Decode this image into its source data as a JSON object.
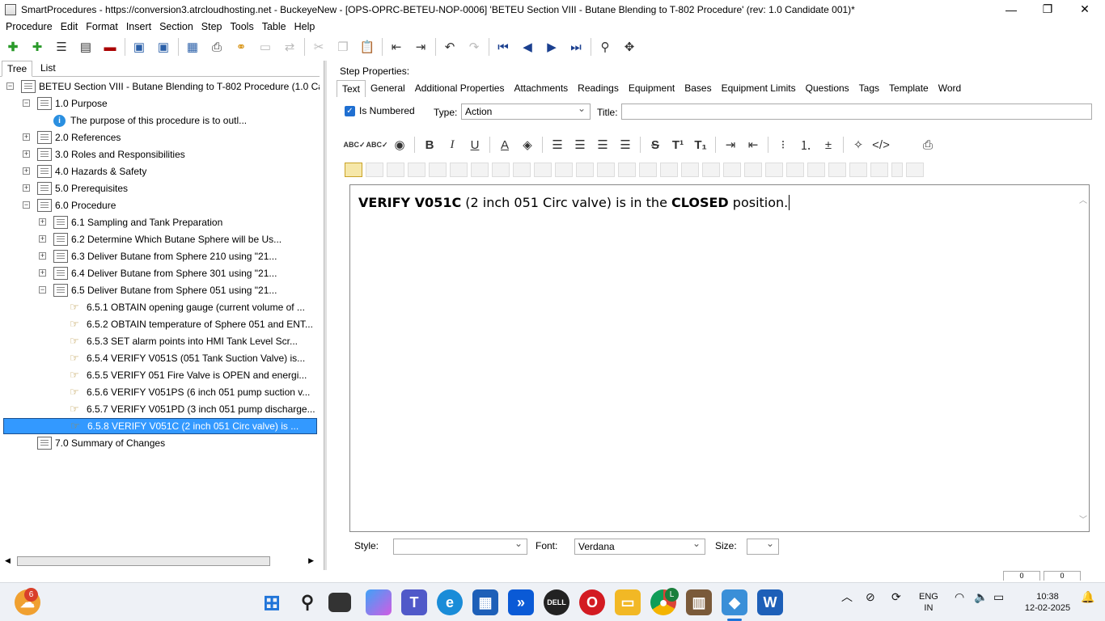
{
  "window": {
    "title": "SmartProcedures - https://conversion3.atrcloudhosting.net - BuckeyeNew - [OPS-OPRC-BETEU-NOP-0006] 'BETEU Section VIII - Butane Blending to T-802 Procedure' (rev: 1.0 Candidate 001)*",
    "minimize": "—",
    "maximize": "❐",
    "close": "✕"
  },
  "menu": [
    "Procedure",
    "Edit",
    "Format",
    "Insert",
    "Section",
    "Step",
    "Tools",
    "Table",
    "Help"
  ],
  "left": {
    "tabs": [
      "Tree",
      "List"
    ],
    "active_tab": "Tree",
    "tree": [
      {
        "label": "BETEU Section VIII - Butane Blending to T-802 Procedure (1.0 Ca...",
        "icon": "document-icon",
        "expander": "−"
      },
      {
        "label": "1.0 Purpose",
        "icon": "document-icon",
        "expander": "−"
      },
      {
        "label": "The purpose of this procedure is to outl...",
        "icon": "info-icon",
        "expander": ""
      },
      {
        "label": "2.0 References",
        "icon": "document-icon",
        "expander": "+"
      },
      {
        "label": "3.0 Roles and Responsibilities",
        "icon": "document-icon",
        "expander": "+"
      },
      {
        "label": "4.0 Hazards & Safety",
        "icon": "document-icon",
        "expander": "+"
      },
      {
        "label": "5.0 Prerequisites",
        "icon": "document-icon",
        "expander": "+"
      },
      {
        "label": "6.0 Procedure",
        "icon": "document-icon",
        "expander": "−"
      },
      {
        "label": "6.1 Sampling and Tank Preparation",
        "icon": "document-icon",
        "expander": "+"
      },
      {
        "label": "6.2 Determine Which Butane Sphere will be Us...",
        "icon": "document-icon",
        "expander": "+"
      },
      {
        "label": "6.3 Deliver Butane from Sphere 210 using \"21...",
        "icon": "document-icon",
        "expander": "+"
      },
      {
        "label": "6.4 Deliver Butane from Sphere 301 using \"21...",
        "icon": "document-icon",
        "expander": "+"
      },
      {
        "label": "6.5 Deliver Butane from Sphere 051 using \"21...",
        "icon": "document-icon",
        "expander": "−"
      },
      {
        "label": "6.5.1 OBTAIN opening gauge (current volume of ...",
        "icon": "hand-icon",
        "expander": ""
      },
      {
        "label": "6.5.2 OBTAIN temperature of Sphere 051 and ENT...",
        "icon": "hand-icon",
        "expander": ""
      },
      {
        "label": "6.5.3 SET alarm points into HMI Tank Level Scr...",
        "icon": "hand-icon",
        "expander": ""
      },
      {
        "label": "6.5.4 VERIFY V051S (051 Tank Suction Valve) is...",
        "icon": "hand-icon",
        "expander": ""
      },
      {
        "label": "6.5.5 VERIFY 051 Fire Valve is OPEN and energi...",
        "icon": "hand-icon",
        "expander": ""
      },
      {
        "label": "6.5.6 VERIFY V051PS (6 inch 051 pump suction v...",
        "icon": "hand-icon",
        "expander": ""
      },
      {
        "label": "6.5.7 VERIFY V051PD (3 inch 051 pump discharge...",
        "icon": "hand-icon",
        "expander": ""
      },
      {
        "label": "6.5.8 VERIFY V051C (2 inch 051 Circ valve) is ...",
        "icon": "hand-icon",
        "expander": "",
        "selected": true
      },
      {
        "label": "7.0 Summary of Changes",
        "icon": "document-icon",
        "expander": ""
      }
    ]
  },
  "step": {
    "header": "Step Properties:",
    "tabs": [
      "Text",
      "General",
      "Additional Properties",
      "Attachments",
      "Readings",
      "Equipment",
      "Bases",
      "Equipment Limits",
      "Questions",
      "Tags",
      "Template",
      "Word"
    ],
    "active_tab": "Text",
    "is_numbered_label": "Is Numbered",
    "is_numbered": true,
    "type_label": "Type:",
    "type_value": "Action",
    "title_label": "Title:",
    "title_value": "",
    "text_parts": [
      {
        "text": "VERIFY V051C",
        "bold": true
      },
      {
        "text": " (2 inch 051 Circ valve) is in the ",
        "bold": false
      },
      {
        "text": "CLOSED",
        "bold": true
      },
      {
        "text": " position.",
        "bold": false
      }
    ],
    "style_label": "Style:",
    "style_value": "",
    "font_label": "Font:",
    "font_value": "Verdana",
    "size_label": "Size:",
    "size_value": ""
  },
  "status": [
    "0",
    "0"
  ],
  "taskbar": {
    "weather_badge": "6",
    "chrome_badge": "L",
    "lang_line1": "ENG",
    "lang_line2": "IN",
    "time": "10:38",
    "date": "12-02-2025"
  },
  "colors": {
    "selection": "#3399ff",
    "accent": "#1f6fd1",
    "taskbar": "#eef1f6"
  }
}
